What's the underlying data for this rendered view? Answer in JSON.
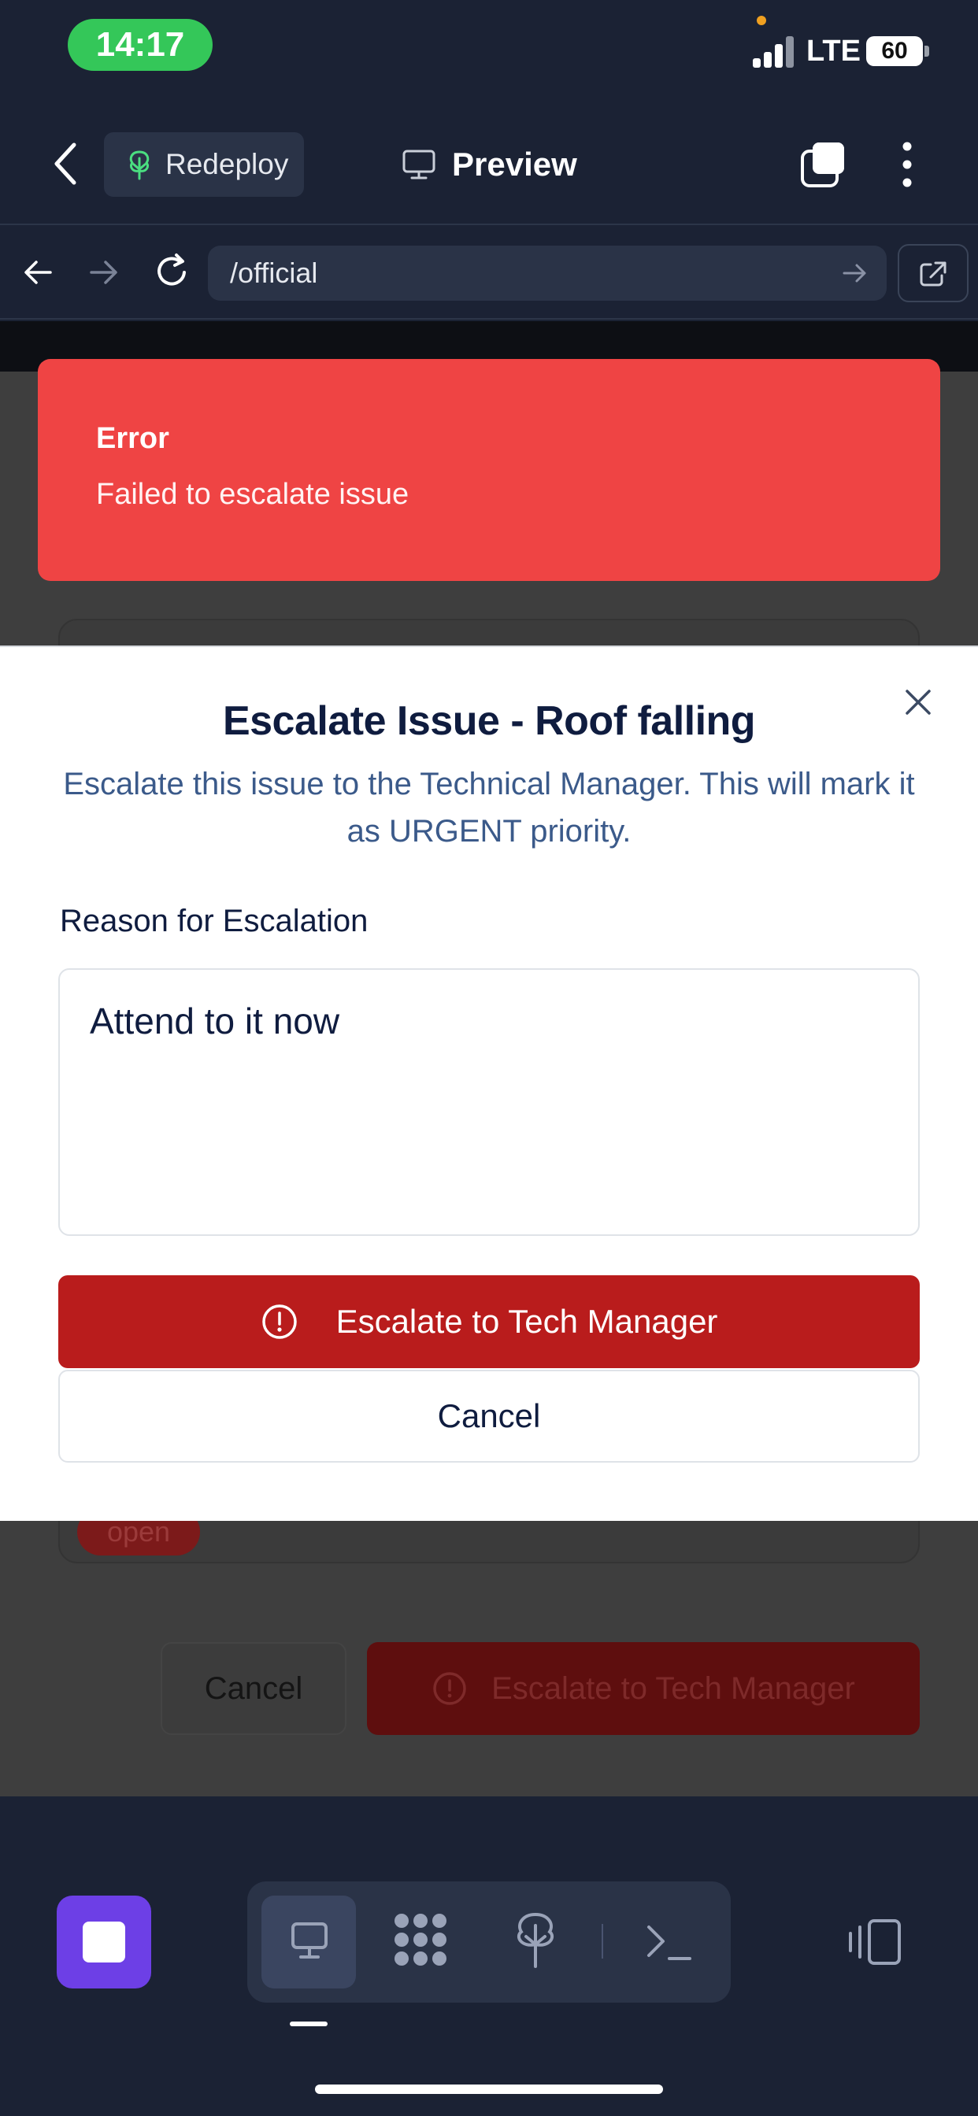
{
  "status_bar": {
    "time": "14:17",
    "network": "LTE",
    "battery": "60"
  },
  "header": {
    "redeploy_label": "Redeploy",
    "preview_label": "Preview"
  },
  "browser": {
    "url": "/official"
  },
  "toast": {
    "title": "Error",
    "message": "Failed to escalate issue",
    "color": "#ef4444"
  },
  "background_page": {
    "badge": "open",
    "cancel_label": "Cancel",
    "escalate_label": "Escalate to Tech Manager"
  },
  "modal": {
    "title": "Escalate Issue - Roof falling",
    "description": "Escalate this issue to the Technical Manager. This will mark it as URGENT priority.",
    "field_label": "Reason for Escalation",
    "reason_value": "Attend to it now",
    "escalate_label": "Escalate to Tech Manager",
    "cancel_label": "Cancel",
    "escalate_color": "#b91c1c"
  },
  "bottom_toolbar": {
    "items": [
      "preview-icon",
      "grid-apps-icon",
      "deploy-icon",
      "terminal-icon"
    ],
    "accent": "#6d3fe6"
  }
}
